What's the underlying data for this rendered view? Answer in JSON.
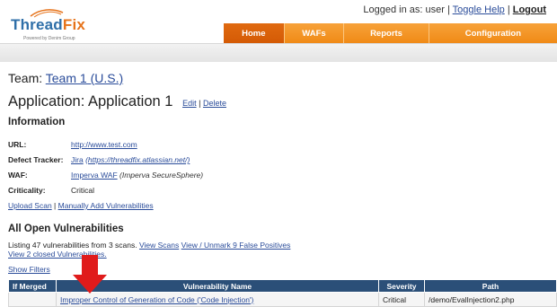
{
  "brand": {
    "logo_text_a": "Thread",
    "logo_text_b": "Fix",
    "tagline": "Powered by Denim Group",
    "logo_orange": "#e6731b",
    "logo_blue": "#2f6fa8"
  },
  "userbar": {
    "logged_in": "Logged in as: user",
    "sep1": "|",
    "toggle_help": "Toggle Help",
    "sep2": "|",
    "logout": "Logout"
  },
  "nav": {
    "tabs": [
      "Home",
      "WAFs",
      "Reports",
      "Configuration"
    ],
    "active_color": "#d45a05",
    "tab_color": "#f08a16"
  },
  "team": {
    "label": "Team:",
    "name": "Team 1 (U.S.)"
  },
  "application": {
    "label": "Application: Application 1",
    "edit": "Edit",
    "sep": "|",
    "delete": "Delete"
  },
  "information": {
    "heading": "Information",
    "url_label": "URL:",
    "url_value": "http://www.test.com",
    "tracker_label": "Defect Tracker:",
    "tracker_name": "Jira",
    "tracker_url": "(https://threadfix.atlassian.net/)",
    "waf_label": "WAF:",
    "waf_name": "Imperva WAF",
    "waf_type": "(Imperva SecureSphere)",
    "criticality_label": "Criticality:",
    "criticality_value": "Critical"
  },
  "actions": {
    "upload_scan": "Upload Scan",
    "sep": "|",
    "manual_add": "Manually Add Vulnerabilities"
  },
  "vulns": {
    "heading": "All Open Vulnerabilities",
    "listing_text": "Listing 47 vulnerabilities from 3 scans.",
    "view_scans": "View Scans",
    "false_positives": "View / Unmark 9 False Positives",
    "closed": "View 2 closed Vulnerabilities.",
    "show_filters": "Show Filters",
    "columns": [
      "If Merged",
      "Vulnerability Name",
      "Severity",
      "Path"
    ],
    "header_color": "#2b4f78",
    "rows": [
      {
        "merged": "",
        "name": "Improper Control of Generation of Code ('Code Injection')",
        "severity": "Critical",
        "path": "/demo/EvalInjection2.php"
      }
    ]
  },
  "annotation": {
    "arrow_color": "#e01b1b"
  }
}
